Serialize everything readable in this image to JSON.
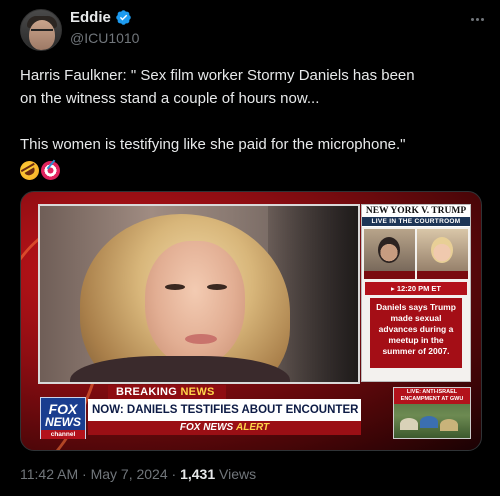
{
  "author": {
    "display_name": "Eddie",
    "handle": "@ICU1010",
    "verified": true
  },
  "tweet": {
    "line1": "Harris Faulkner: \" Sex film worker Stormy Daniels has been",
    "line2": "on the witness stand a couple of hours now...",
    "line3": "This women is testifying like she paid for the microphone.\"",
    "emojis": [
      "rolling-on-floor-laughing",
      "direct-hit"
    ]
  },
  "media": {
    "side_header_line1": "NEW YORK V. TRUMP",
    "side_header_line2": "LIVE IN THE COURTROOM",
    "time": "▸ 12:20 PM ET",
    "side_note": "Daniels says Trump made sexual advances during a meetup in the summer of 2007.",
    "breaking_prefix": "BREAKING ",
    "breaking_suffix": "NEWS",
    "headline": "NOW: DANIELS TESTIFIES ABOUT ENCOUNTER W/ TRUMP",
    "brand_prefix": "FOX NEWS ",
    "brand_suffix": "ALERT",
    "logo_line1": "FOX",
    "logo_line2": "NEWS",
    "logo_line3": "channel",
    "live_caption": "LIVE: ANTI-ISRAEL ENCAMPMENT AT GWU"
  },
  "meta": {
    "time": "11:42 AM",
    "sep1": " · ",
    "date": "May 7, 2024",
    "sep2": " · ",
    "views_count": "1,431",
    "views_label": " Views"
  },
  "colors": {
    "background": "#000000",
    "text": "#e7e9ea",
    "muted": "#71767b",
    "verified": "#1d9bf0"
  }
}
